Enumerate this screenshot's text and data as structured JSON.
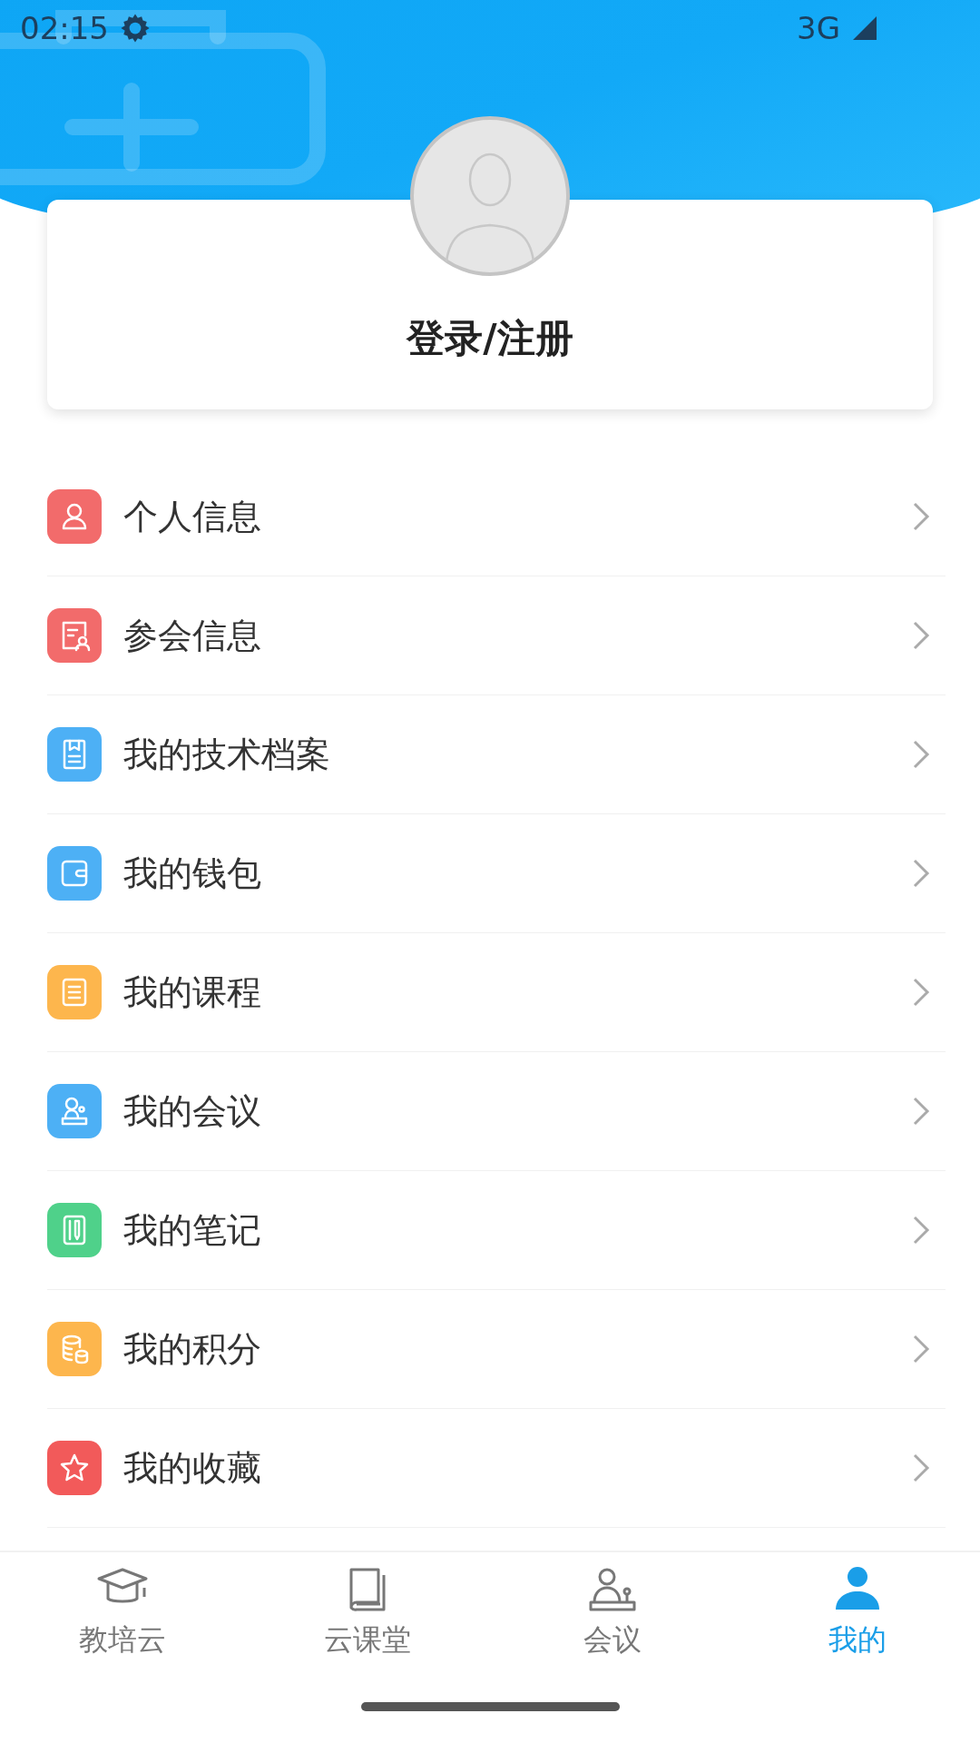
{
  "status_bar": {
    "time": "02:15",
    "network": "3G"
  },
  "profile": {
    "login_label": "登录/注册"
  },
  "menu": [
    {
      "label": "个人信息",
      "kind": "person",
      "color": "#f26b6b"
    },
    {
      "label": "参会信息",
      "kind": "attendee",
      "color": "#f26b6b"
    },
    {
      "label": "我的技术档案",
      "kind": "archive",
      "color": "#4db0f5"
    },
    {
      "label": "我的钱包",
      "kind": "wallet",
      "color": "#4db0f5"
    },
    {
      "label": "我的课程",
      "kind": "course",
      "color": "#fdb64d"
    },
    {
      "label": "我的会议",
      "kind": "meeting",
      "color": "#4db0f5"
    },
    {
      "label": "我的笔记",
      "kind": "note",
      "color": "#4fd18a"
    },
    {
      "label": "我的积分",
      "kind": "points",
      "color": "#fdb64d"
    },
    {
      "label": "我的收藏",
      "kind": "favorite",
      "color": "#f25a5a"
    }
  ],
  "tabs": [
    {
      "label": "教培云",
      "kind": "cap",
      "selected": false
    },
    {
      "label": "云课堂",
      "kind": "book",
      "selected": false
    },
    {
      "label": "会议",
      "kind": "meeting",
      "selected": false
    },
    {
      "label": "我的",
      "kind": "user",
      "selected": true
    }
  ]
}
